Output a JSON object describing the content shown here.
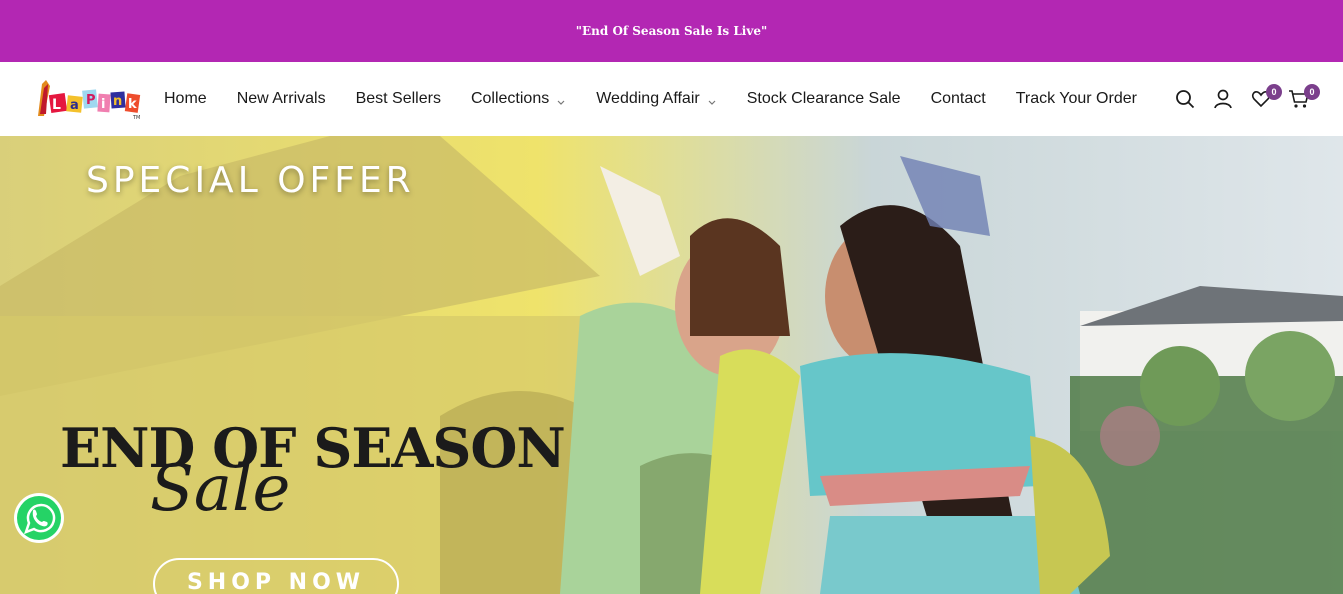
{
  "announcement": {
    "text": "\"End Of Season Sale Is Live\""
  },
  "brand": {
    "logo_text": "La Pink",
    "color": "#b327b3"
  },
  "nav": {
    "items": [
      {
        "label": "Home",
        "has_dropdown": false
      },
      {
        "label": "New Arrivals",
        "has_dropdown": false
      },
      {
        "label": "Best Sellers",
        "has_dropdown": false
      },
      {
        "label": "Collections",
        "has_dropdown": true
      },
      {
        "label": "Wedding Affair",
        "has_dropdown": true
      },
      {
        "label": "Stock Clearance Sale",
        "has_dropdown": false
      },
      {
        "label": "Contact",
        "has_dropdown": false
      },
      {
        "label": "Track Your Order",
        "has_dropdown": false
      }
    ]
  },
  "header_icons": {
    "search": "search-icon",
    "account": "user-icon",
    "wishlist": "heart-icon",
    "wishlist_count": "0",
    "cart": "cart-icon",
    "cart_count": "0"
  },
  "hero": {
    "eyebrow": "SPECIAL OFFER",
    "headline": "END OF SEASON",
    "script": "Sale",
    "cta": "SHOP NOW"
  },
  "floating": {
    "whatsapp": "whatsapp-icon",
    "whatsapp_color": "#25d366"
  }
}
